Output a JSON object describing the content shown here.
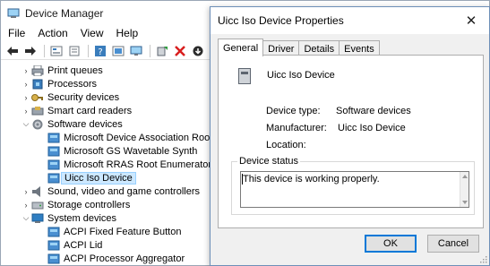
{
  "device_manager": {
    "title": "Device Manager",
    "menu": [
      "File",
      "Action",
      "View",
      "Help"
    ],
    "toolbar_icons": [
      "back-arrow-icon",
      "forward-arrow-icon",
      "device-tree-icon",
      "properties-icon",
      "help-icon",
      "device-icon",
      "monitor-icon",
      "update-driver-icon",
      "uninstall-icon",
      "download-icon"
    ],
    "tree": [
      {
        "label": "Print queues",
        "icon": "printer-icon",
        "expander": ">",
        "level": 1
      },
      {
        "label": "Processors",
        "icon": "chip-icon",
        "expander": ">",
        "level": 1
      },
      {
        "label": "Security devices",
        "icon": "key-icon",
        "expander": ">",
        "level": 1
      },
      {
        "label": "Smart card readers",
        "icon": "card-reader-icon",
        "expander": ">",
        "level": 1
      },
      {
        "label": "Software devices",
        "icon": "gear-icon",
        "expander": "v",
        "level": 1
      },
      {
        "label": "Microsoft Device Association Root Enu",
        "icon": "device-icon",
        "expander": "",
        "level": 2
      },
      {
        "label": "Microsoft GS Wavetable Synth",
        "icon": "device-icon",
        "expander": "",
        "level": 2
      },
      {
        "label": "Microsoft RRAS Root Enumerator",
        "icon": "device-icon",
        "expander": "",
        "level": 2
      },
      {
        "label": "Uicc Iso Device",
        "icon": "device-icon",
        "expander": "",
        "level": 2,
        "selected": true
      },
      {
        "label": "Sound, video and game controllers",
        "icon": "speaker-icon",
        "expander": ">",
        "level": 1
      },
      {
        "label": "Storage controllers",
        "icon": "storage-icon",
        "expander": ">",
        "level": 1
      },
      {
        "label": "System devices",
        "icon": "computer-icon",
        "expander": "v",
        "level": 1
      },
      {
        "label": "ACPI Fixed Feature Button",
        "icon": "device-icon",
        "expander": "",
        "level": 2
      },
      {
        "label": "ACPI Lid",
        "icon": "device-icon",
        "expander": "",
        "level": 2
      },
      {
        "label": "ACPI Processor Aggregator",
        "icon": "device-icon",
        "expander": "",
        "level": 2
      }
    ]
  },
  "properties_dialog": {
    "title": "Uicc Iso Device Properties",
    "close_glyph": "✕",
    "tabs": [
      "General",
      "Driver",
      "Details",
      "Events"
    ],
    "active_tab": "General",
    "device_name": "Uicc Iso Device",
    "fields": [
      {
        "label": "Device type:",
        "value": "Software devices"
      },
      {
        "label": "Manufacturer:",
        "value": "Uicc Iso Device"
      },
      {
        "label": "Location:",
        "value": ""
      }
    ],
    "status_legend": "Device status",
    "status_text": "This device is working properly.",
    "ok_label": "OK",
    "cancel_label": "Cancel"
  },
  "colors": {
    "selection_bg": "#cce8ff",
    "accent": "#0078d7",
    "dialog_bg": "#f0f0f0"
  }
}
